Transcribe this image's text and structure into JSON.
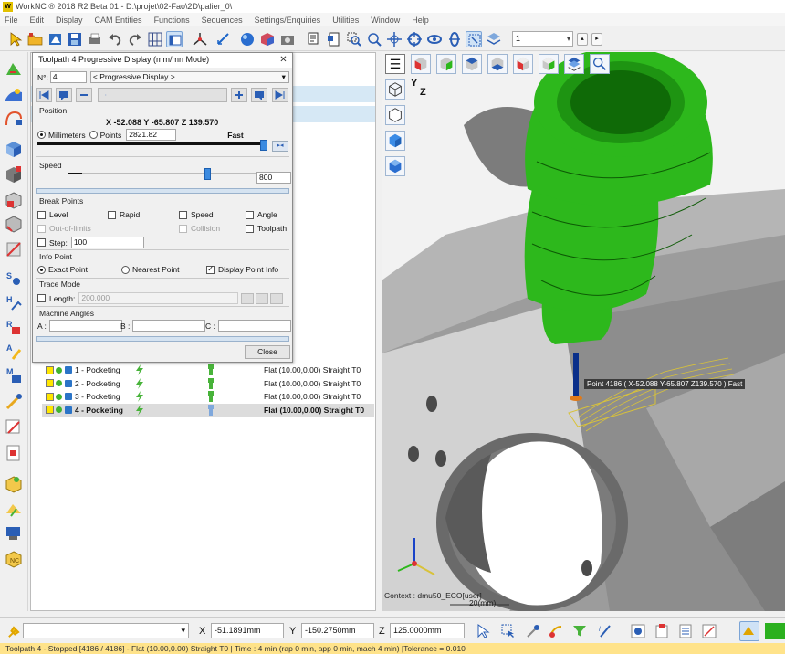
{
  "window": {
    "title": "WorkNC ® 2018 R2 Beta 01 - D:\\projet\\02-Fao\\2D\\palier_0\\"
  },
  "menu": [
    "File",
    "Edit",
    "Display",
    "CAM Entities",
    "Functions",
    "Sequences",
    "Settings/Enquiries",
    "Utilities",
    "Window",
    "Help"
  ],
  "toolbar": {
    "layer_value": "1"
  },
  "dialog": {
    "title": "Toolpath 4 Progressive Display (mm/mn Mode)",
    "close": "✕",
    "n_label": "N°:",
    "n_value": "4",
    "mode_value": "< Progressive Display >",
    "position_header": "Position",
    "position_readout": "X -52.088 Y -65.807 Z 139.570",
    "millimeters_label": "Millimeters",
    "points_label": "Points",
    "points_value": "2821.82",
    "fast_label": "Fast",
    "speed_header": "Speed",
    "speed_value": "800",
    "break_points_header": "Break Points",
    "level_label": "Level",
    "rapid_label": "Rapid",
    "speed_label": "Speed",
    "angle_label": "Angle",
    "out_of_limits_label": "Out-of-limits",
    "collision_label": "Collision",
    "toolpath_label": "Toolpath",
    "step_label": "Step:",
    "step_value": "100",
    "info_point_header": "Info Point",
    "exact_point_label": "Exact Point",
    "nearest_point_label": "Nearest Point",
    "display_point_info_label": "Display Point Info",
    "trace_mode_header": "Trace Mode",
    "length_label": "Length:",
    "length_value": "200.000",
    "machine_angles_header": "Machine Angles",
    "a_label": "A :",
    "b_label": "B :",
    "c_label": "C :",
    "close_label": "Close"
  },
  "toolpaths": [
    {
      "name": "1 - Pocketing",
      "desc": "Flat (10.00,0.00) Straight T0"
    },
    {
      "name": "2 - Pocketing",
      "desc": "Flat (10.00,0.00) Straight T0"
    },
    {
      "name": "3 - Pocketing",
      "desc": "Flat (10.00,0.00) Straight T0"
    },
    {
      "name": "4 - Pocketing",
      "desc": "Flat (10.00,0.00) Straight T0"
    }
  ],
  "viewport": {
    "point_tooltip": "Point 4186 ( X-52.088 Y-65.807 Z139.570 ) Fast",
    "context_label": "Context : dmu50_ECO[user]",
    "scale_label": "20(mm)",
    "axis_y": "Y",
    "axis_z": "Z"
  },
  "coords": {
    "x_label": "X",
    "x_value": "-51.1891mm",
    "y_label": "Y",
    "y_value": "-150.2750mm",
    "z_label": "Z",
    "z_value": "125.0000mm"
  },
  "status": "Toolpath 4 - Stopped [4186 / 4186] - Flat (10.00,0.00) Straight T0 | Time : 4 min (rap 0 min, app 0 min, mach 4 min) |Tolerance = 0.010",
  "colors": {
    "tool_green": "#2db81c",
    "status_yellow": "#ffe38a",
    "selection_blue": "#d6e8f5"
  }
}
